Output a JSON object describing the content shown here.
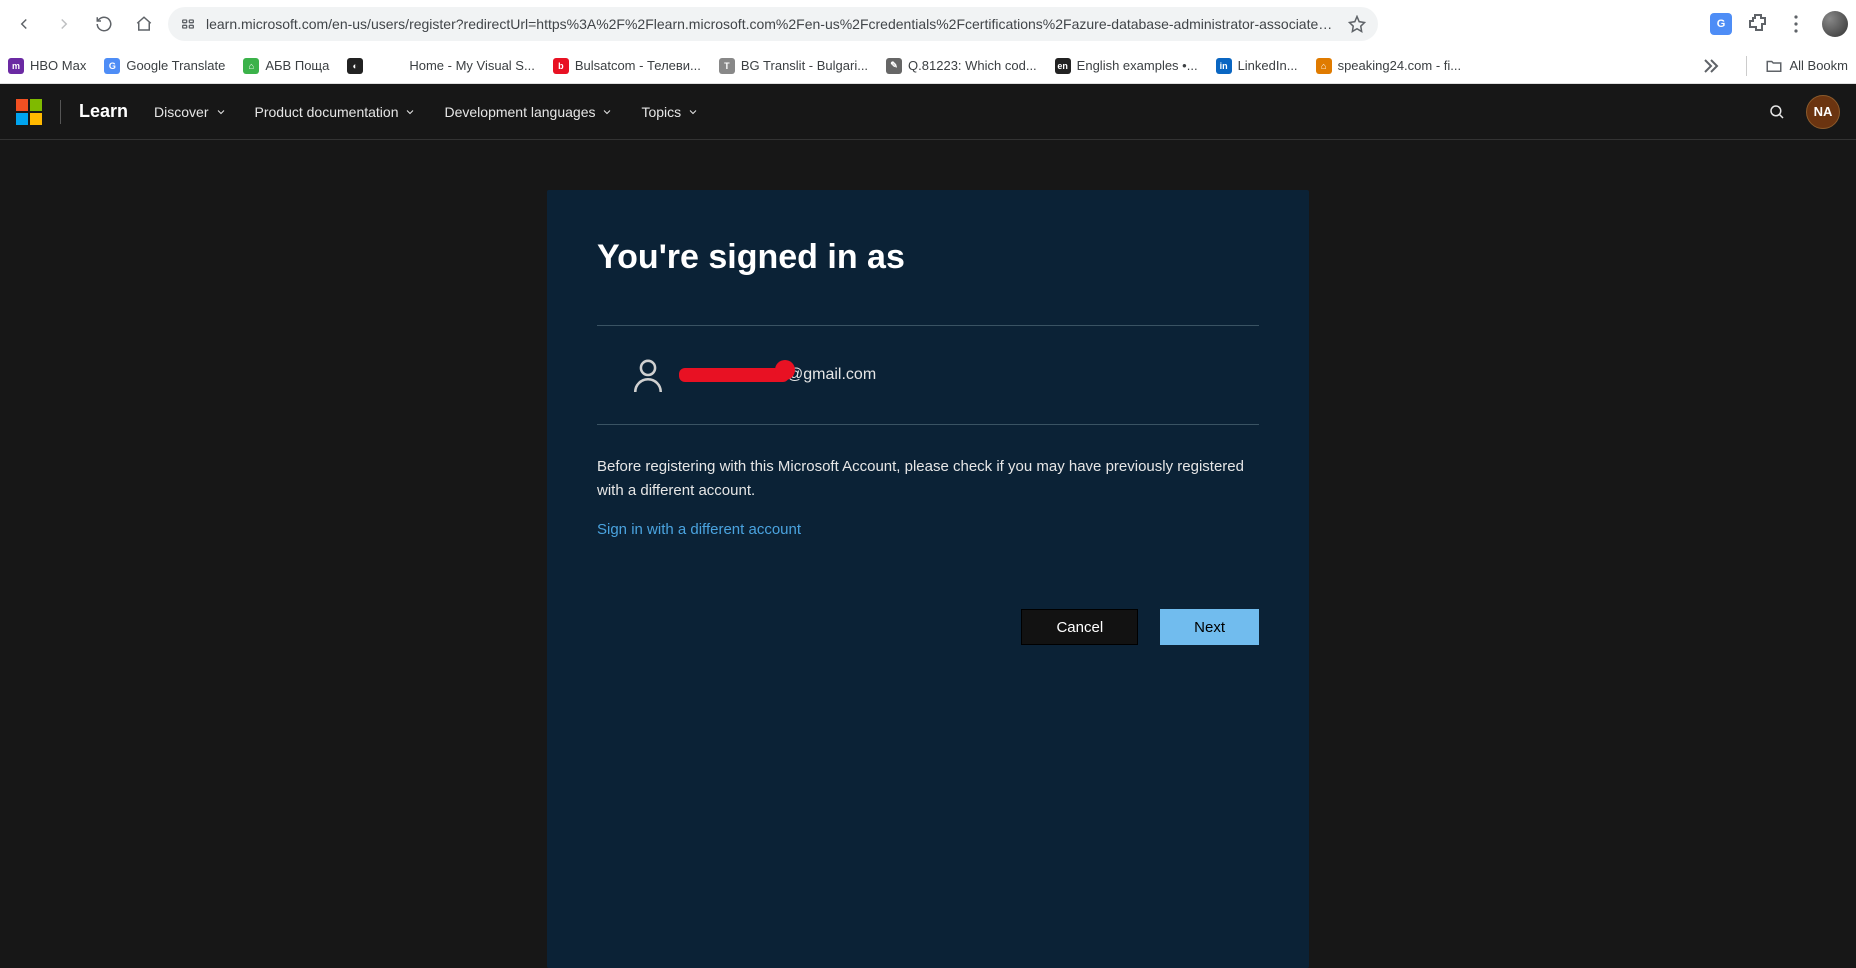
{
  "browser": {
    "url": "learn.microsoft.com/en-us/users/register?redirectUrl=https%3A%2F%2Flearn.microsoft.com%2Fen-us%2Fcredentials%2Fcertifications%2Fazure-database-administrator-associate%2F..."
  },
  "bookmarks": {
    "items": [
      "HBO Max",
      "Google Translate",
      "АБВ Поща",
      "",
      "Home - My Visual S...",
      "Bulsatcom - Телеви...",
      "BG Translit - Bulgari...",
      "Q.81223: Which cod...",
      "English examples •...",
      "LinkedIn...",
      "speaking24.com - fi..."
    ],
    "all_label": "All Bookm"
  },
  "header": {
    "brand": "Learn",
    "nav": [
      "Discover",
      "Product documentation",
      "Development languages",
      "Topics"
    ],
    "avatar_initials": "NA"
  },
  "card": {
    "title": "You're signed in as",
    "email_suffix": "@gmail.com",
    "note": "Before registering with this Microsoft Account, please check if you may have previously registered with a different account.",
    "link_label": "Sign in with a different account",
    "cancel_label": "Cancel",
    "next_label": "Next"
  }
}
